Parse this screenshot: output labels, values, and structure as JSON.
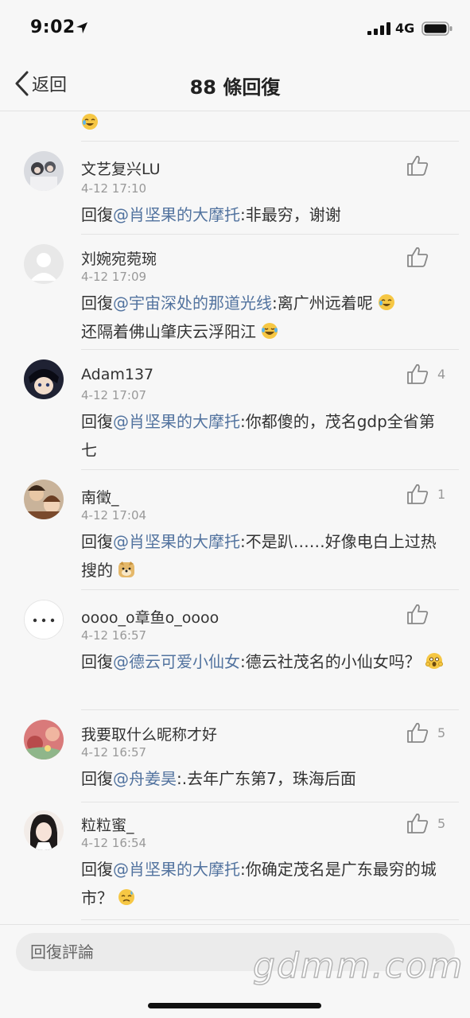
{
  "status_bar": {
    "time": "9:02",
    "network": "4G"
  },
  "nav": {
    "back_label": "返回",
    "title": "88 條回復"
  },
  "comments": [
    {
      "name": "文艺复兴LU",
      "time": "4-12 17:10",
      "prefix": "回復",
      "mention": "@肖坚果的大摩托",
      "text": ":非最穷，谢谢",
      "likes": "",
      "emoji": ""
    },
    {
      "name": "刘婉宛菀琬",
      "time": "4-12 17:09",
      "prefix": "回復",
      "mention": "@宇宙深处的那道光线",
      "text": ":离广州远着呢",
      "text2": "还隔着佛山肇庆云浮阳江",
      "likes": "",
      "emoji": "laughing-crying-emoji",
      "emoji2": "tears-of-joy-emoji"
    },
    {
      "name": "Adam137",
      "time": "4-12 17:07",
      "prefix": "回復",
      "mention": "@肖坚果的大摩托",
      "text": ":你都傻的，茂名gdp全省第七",
      "likes": "4",
      "emoji": ""
    },
    {
      "name": "南徵_",
      "time": "4-12 17:04",
      "prefix": "回復",
      "mention": "@肖坚果的大摩托",
      "text": ":不是趴……好像电白上过热搜的",
      "likes": "1",
      "emoji": "doge-emoji"
    },
    {
      "name": "oooo_o章鱼o_oooo",
      "time": "4-12 16:57",
      "prefix": "回復",
      "mention": "@德云可爱小仙女",
      "text": ":德云社茂名的小仙女吗？",
      "likes": "",
      "emoji": "shocked-emoji"
    },
    {
      "name": "我要取什么昵称才好",
      "time": "4-12 16:57",
      "prefix": "回復",
      "mention": "@舟姜昊",
      "text": ":.去年广东第7，珠海后面",
      "likes": "5",
      "emoji": ""
    },
    {
      "name": "粒粒蜜_",
      "time": "4-12 16:54",
      "prefix": "回復",
      "mention": "@肖坚果的大摩托",
      "text": ":你确定茂名是广东最穷的城市？",
      "likes": "5",
      "emoji": "sad-sweat-emoji"
    }
  ],
  "reply_bar": {
    "placeholder": "回復評論"
  },
  "watermark": "gdmm.com",
  "colors": {
    "mention": "#52739f",
    "background": "#f7f7f7",
    "secondary_text": "#999999"
  }
}
